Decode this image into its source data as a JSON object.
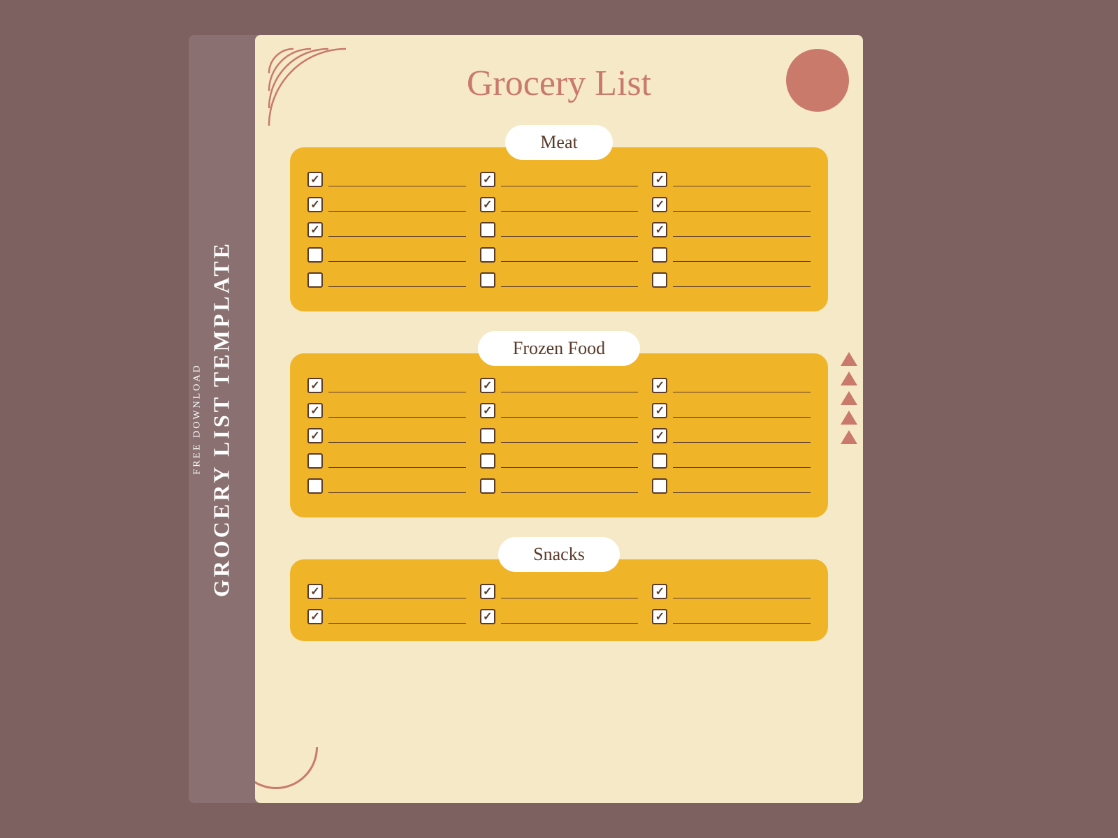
{
  "background_color": "#7d6060",
  "sidebar": {
    "free_download": "FREE DOWNLOAD",
    "main_title": "GROCERY LIST TEMPLATE"
  },
  "page": {
    "title": "Grocery List",
    "sections": [
      {
        "id": "meat",
        "title": "Meat",
        "columns": 3,
        "rows_per_col": 5,
        "checkboxes": [
          [
            true,
            true,
            false,
            false,
            false
          ],
          [
            true,
            true,
            false,
            false,
            false
          ],
          [
            true,
            true,
            true,
            false,
            false
          ]
        ]
      },
      {
        "id": "frozen-food",
        "title": "Frozen Food",
        "columns": 3,
        "rows_per_col": 5,
        "checkboxes": [
          [
            true,
            true,
            true,
            false,
            false
          ],
          [
            true,
            true,
            false,
            false,
            false
          ],
          [
            true,
            true,
            true,
            false,
            false
          ]
        ]
      },
      {
        "id": "snacks",
        "title": "Snacks",
        "columns": 3,
        "rows_per_col": 2,
        "checkboxes": [
          [
            true,
            true
          ],
          [
            true,
            true
          ],
          [
            true,
            true
          ]
        ]
      }
    ]
  },
  "colors": {
    "background": "#7d6060",
    "page_bg": "#f5e9c8",
    "section_bg": "#f0b429",
    "title_color": "#c97a6a",
    "text_dark": "#5a3a2a",
    "deco_color": "#c97a6a"
  }
}
